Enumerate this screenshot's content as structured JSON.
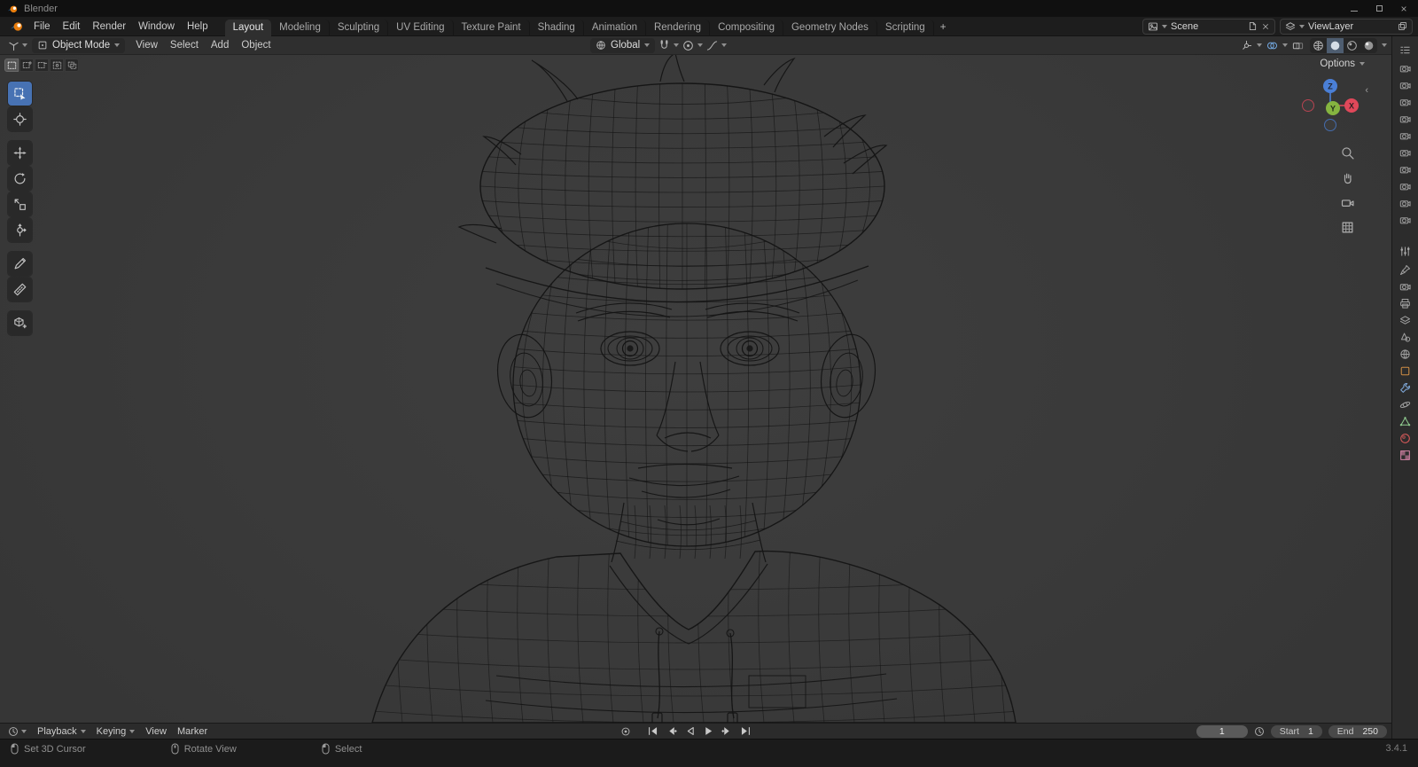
{
  "window": {
    "title": "Blender",
    "controls": [
      "minimize",
      "maximize",
      "close"
    ]
  },
  "topbar": {
    "app_menus": [
      "File",
      "Edit",
      "Render",
      "Window",
      "Help"
    ],
    "workspaces": [
      "Layout",
      "Modeling",
      "Sculpting",
      "UV Editing",
      "Texture Paint",
      "Shading",
      "Animation",
      "Rendering",
      "Compositing",
      "Geometry Nodes",
      "Scripting"
    ],
    "active_workspace": "Layout",
    "new_workspace_label": "+",
    "scene_field": {
      "value": "Scene"
    },
    "view_layer_field": {
      "value": "ViewLayer"
    }
  },
  "viewport": {
    "header": {
      "mode": "Object Mode",
      "menus": [
        "View",
        "Select",
        "Add",
        "Object"
      ],
      "orientation": "Global",
      "shading_modes": [
        "wireframe",
        "solid",
        "material",
        "rendered"
      ],
      "active_shading": "solid"
    },
    "options_label": "Options",
    "select_modes": [
      "new",
      "extend",
      "subtract",
      "invert",
      "intersect"
    ],
    "tools": [
      "select-box",
      "cursor",
      "move",
      "rotate",
      "scale",
      "transform",
      "annotate",
      "measure",
      "add-cube"
    ],
    "active_tool": "select-box",
    "gizmo_axes": {
      "x": "X",
      "y": "Y",
      "z": "Z"
    },
    "nav_buttons": [
      "zoom",
      "pan",
      "camera-view",
      "toggle-orthographic"
    ]
  },
  "timeline": {
    "menus": [
      {
        "label": "Playback",
        "caret": true
      },
      {
        "label": "Keying",
        "caret": true
      },
      {
        "label": "View",
        "caret": false
      },
      {
        "label": "Marker",
        "caret": false
      }
    ],
    "transport": [
      "jump-to-start",
      "previous-keyframe",
      "play-reverse",
      "play",
      "next-keyframe",
      "jump-to-end"
    ],
    "current_frame": "1",
    "start": {
      "label": "Start",
      "value": "1"
    },
    "end": {
      "label": "End",
      "value": "250"
    }
  },
  "right_rail": {
    "outliner_icons": [
      "camera",
      "camera",
      "camera",
      "camera",
      "camera",
      "camera",
      "camera",
      "camera",
      "camera",
      "camera"
    ],
    "property_tabs": [
      {
        "name": "active-tool",
        "color": "#a0a0a0"
      },
      {
        "name": "render",
        "color": "#a0a0a0"
      },
      {
        "name": "output",
        "color": "#a0a0a0"
      },
      {
        "name": "view-layer",
        "color": "#a0a0a0"
      },
      {
        "name": "scene",
        "color": "#a0a0a0"
      },
      {
        "name": "world",
        "color": "#a0a0a0"
      },
      {
        "name": "object",
        "color": "#cf8d44"
      },
      {
        "name": "modifiers",
        "color": "#7fa8d8"
      },
      {
        "name": "physics",
        "color": "#a0a0a0"
      },
      {
        "name": "object-data",
        "color": "#8fca8f"
      },
      {
        "name": "material",
        "color": "#d05858"
      },
      {
        "name": "texture",
        "color": "#d784a8"
      }
    ]
  },
  "status_bar": {
    "hints": [
      {
        "icon": "mouse-left-icon",
        "label": "Set 3D Cursor"
      },
      {
        "icon": "mouse-middle-icon",
        "label": "Rotate View"
      },
      {
        "icon": "mouse-left-icon",
        "label": "Select"
      }
    ],
    "version": "3.4.1"
  },
  "colors": {
    "accent": "#4772b3",
    "axis_x": "#e0485a",
    "axis_y": "#85b440",
    "axis_z": "#4a7fd6",
    "viewport_bg": "#3b3b3b"
  }
}
